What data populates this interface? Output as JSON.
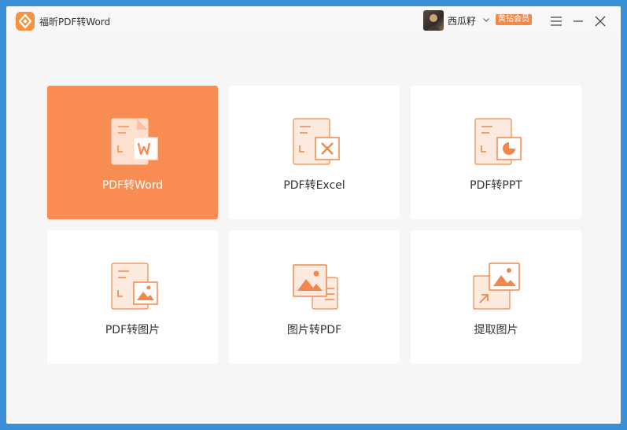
{
  "app": {
    "title": "福昕PDF转Word"
  },
  "user": {
    "name": "西瓜籽",
    "badge": "黄钻会员"
  },
  "colors": {
    "accent": "#f98c52",
    "card_bg": "#ffffff",
    "window_bg": "#f6f6f6",
    "icon_stroke": "#f0884b"
  },
  "cards": [
    {
      "label": "PDF转Word",
      "icon": "pdf-to-word-icon",
      "active": true
    },
    {
      "label": "PDF转Excel",
      "icon": "pdf-to-excel-icon",
      "active": false
    },
    {
      "label": "PDF转PPT",
      "icon": "pdf-to-ppt-icon",
      "active": false
    },
    {
      "label": "PDF转图片",
      "icon": "pdf-to-image-icon",
      "active": false
    },
    {
      "label": "图片转PDF",
      "icon": "image-to-pdf-icon",
      "active": false
    },
    {
      "label": "提取图片",
      "icon": "extract-image-icon",
      "active": false
    }
  ]
}
